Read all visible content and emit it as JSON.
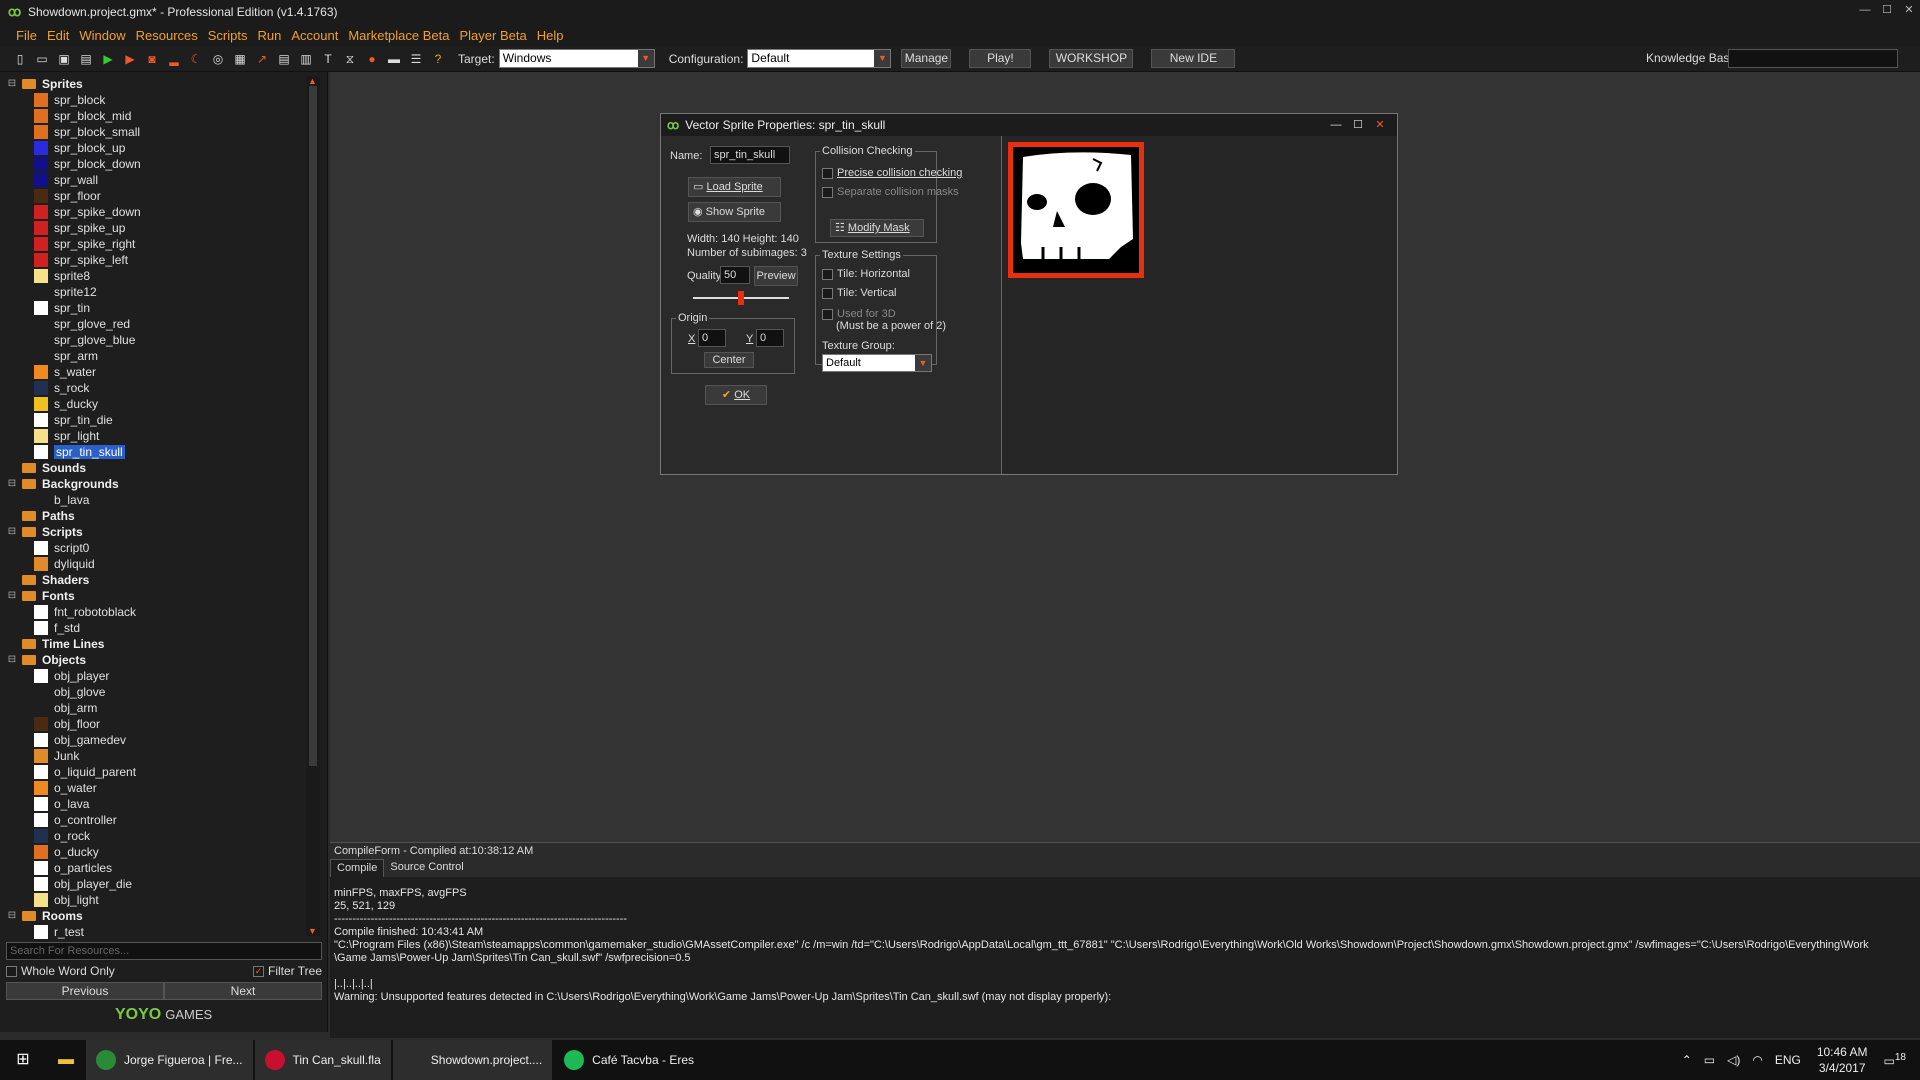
{
  "window": {
    "title": "Showdown.project.gmx* - Professional Edition (v1.4.1763)"
  },
  "menu": [
    "File",
    "Edit",
    "Window",
    "Resources",
    "Scripts",
    "Run",
    "Account",
    "Marketplace Beta",
    "Player Beta",
    "Help"
  ],
  "toolbar": {
    "target_label": "Target:",
    "target_value": "Windows",
    "config_label": "Configuration:",
    "config_value": "Default",
    "manage": "Manage",
    "play": "Play!",
    "workshop": "WORKSHOP",
    "new_ide": "New IDE",
    "kb_label": "Knowledge Base:"
  },
  "tree": [
    {
      "type": "folder",
      "label": "Sprites",
      "expanded": true
    },
    {
      "type": "res",
      "label": "spr_block",
      "color": "#e07020"
    },
    {
      "type": "res",
      "label": "spr_block_mid",
      "color": "#e07020"
    },
    {
      "type": "res",
      "label": "spr_block_small",
      "color": "#e07020"
    },
    {
      "type": "res",
      "label": "spr_block_up",
      "color": "#2a2ae0"
    },
    {
      "type": "res",
      "label": "spr_block_down",
      "color": "#10108a"
    },
    {
      "type": "res",
      "label": "spr_wall",
      "color": "#10108a"
    },
    {
      "type": "res",
      "label": "spr_floor",
      "color": "#4a2a10"
    },
    {
      "type": "res",
      "label": "spr_spike_down",
      "color": "#d02020"
    },
    {
      "type": "res",
      "label": "spr_spike_up",
      "color": "#d02020"
    },
    {
      "type": "res",
      "label": "spr_spike_right",
      "color": "#d02020"
    },
    {
      "type": "res",
      "label": "spr_spike_left",
      "color": "#d02020"
    },
    {
      "type": "res",
      "label": "sprite8",
      "color": "#f6e08a"
    },
    {
      "type": "res",
      "label": "sprite12",
      "color": "#1e1e1e"
    },
    {
      "type": "res",
      "label": "spr_tin",
      "color": "#ffffff"
    },
    {
      "type": "res",
      "label": "spr_glove_red",
      "color": "#1e1e1e"
    },
    {
      "type": "res",
      "label": "spr_glove_blue",
      "color": "#1e1e1e"
    },
    {
      "type": "res",
      "label": "spr_arm",
      "color": "#1e1e1e"
    },
    {
      "type": "res",
      "label": "s_water",
      "color": "#f08a20"
    },
    {
      "type": "res",
      "label": "s_rock",
      "color": "#203050"
    },
    {
      "type": "res",
      "label": "s_ducky",
      "color": "#f0c020"
    },
    {
      "type": "res",
      "label": "spr_tin_die",
      "color": "#ffffff"
    },
    {
      "type": "res",
      "label": "spr_light",
      "color": "#f6e08a"
    },
    {
      "type": "res",
      "label": "spr_tin_skull",
      "color": "#ffffff",
      "selected": true
    },
    {
      "type": "folder",
      "label": "Sounds",
      "expanded": false
    },
    {
      "type": "folder",
      "label": "Backgrounds",
      "expanded": true
    },
    {
      "type": "res",
      "label": "b_lava",
      "color": "#1e1e1e"
    },
    {
      "type": "folder",
      "label": "Paths",
      "expanded": false
    },
    {
      "type": "folder",
      "label": "Scripts",
      "expanded": true
    },
    {
      "type": "res",
      "label": "script0",
      "color": "#ffffff"
    },
    {
      "type": "res",
      "label": "dyliquid",
      "color": "#e08a2a"
    },
    {
      "type": "folder",
      "label": "Shaders",
      "expanded": false
    },
    {
      "type": "folder",
      "label": "Fonts",
      "expanded": true
    },
    {
      "type": "res",
      "label": "fnt_robotoblack",
      "color": "#ffffff"
    },
    {
      "type": "res",
      "label": "f_std",
      "color": "#ffffff"
    },
    {
      "type": "folder",
      "label": "Time Lines",
      "expanded": false
    },
    {
      "type": "folder",
      "label": "Objects",
      "expanded": true
    },
    {
      "type": "res",
      "label": "obj_player",
      "color": "#ffffff"
    },
    {
      "type": "res",
      "label": "obj_glove",
      "color": "#1e1e1e"
    },
    {
      "type": "res",
      "label": "obj_arm",
      "color": "#1e1e1e"
    },
    {
      "type": "res",
      "label": "obj_floor",
      "color": "#4a2a10"
    },
    {
      "type": "res",
      "label": "obj_gamedev",
      "color": "#ffffff"
    },
    {
      "type": "res",
      "label": "Junk",
      "color": "#e08a2a"
    },
    {
      "type": "res",
      "label": "o_liquid_parent",
      "color": "#ffffff"
    },
    {
      "type": "res",
      "label": "o_water",
      "color": "#f08a20"
    },
    {
      "type": "res",
      "label": "o_lava",
      "color": "#ffffff"
    },
    {
      "type": "res",
      "label": "o_controller",
      "color": "#ffffff"
    },
    {
      "type": "res",
      "label": "o_rock",
      "color": "#203050"
    },
    {
      "type": "res",
      "label": "o_ducky",
      "color": "#e07020"
    },
    {
      "type": "res",
      "label": "o_particles",
      "color": "#ffffff"
    },
    {
      "type": "res",
      "label": "obj_player_die",
      "color": "#ffffff"
    },
    {
      "type": "res",
      "label": "obj_light",
      "color": "#f6e08a"
    },
    {
      "type": "folder",
      "label": "Rooms",
      "expanded": true
    },
    {
      "type": "res",
      "label": "r_test",
      "color": "#ffffff"
    }
  ],
  "left_bottom": {
    "search_placeholder": "Search For Resources...",
    "whole_word": "Whole Word Only",
    "filter_tree": "Filter Tree",
    "previous": "Previous",
    "next": "Next",
    "logo_yoyo": "YOYO",
    "logo_games": "GAMES"
  },
  "dialog": {
    "title": "Vector Sprite Properties: spr_tin_skull",
    "name_label": "Name:",
    "name_value": "spr_tin_skull",
    "load_sprite": "Load Sprite",
    "show_sprite": "Show Sprite",
    "width_height": "Width: 140    Height: 140",
    "subimages": "Number of subimages: 3",
    "quality_label": "Quality:",
    "quality_value": "50",
    "preview": "Preview",
    "quality_slider_value": 0.5,
    "origin_title": "Origin",
    "x_label": "X",
    "x_value": "0",
    "y_label": "Y",
    "y_value": "0",
    "center": "Center",
    "ok": "OK",
    "collision_title": "Collision Checking",
    "precise": "Precise collision checking",
    "separate": "Separate collision masks",
    "modify_mask": "Modify Mask",
    "texture_title": "Texture Settings",
    "tile_h": "Tile: Horizontal",
    "tile_v": "Tile: Vertical",
    "used_3d": "Used for 3D",
    "power2": "(Must be a power of 2)",
    "texture_group_label": "Texture Group:",
    "texture_group_value": "Default"
  },
  "compile": {
    "header": "CompileForm - Compiled at:10:38:12 AM",
    "tab_compile": "Compile",
    "tab_source": "Source Control",
    "output": "minFPS, maxFPS, avgFPS\n25, 521, 129\n--------------------------------------------------------------------------------\nCompile finished: 10:43:41 AM\n\"C:\\Program Files (x86)\\Steam\\steamapps\\common\\gamemaker_studio\\GMAssetCompiler.exe\" /c /m=win /td=\"C:\\Users\\Rodrigo\\AppData\\Local\\gm_ttt_67881\" \"C:\\Users\\Rodrigo\\Everything\\Work\\Old Works\\Showdown\\Project\\Showdown.gmx\\Showdown.project.gmx\" /swfimages=\"C:\\Users\\Rodrigo\\Everything\\Work\n\\Game Jams\\Power-Up Jam\\Sprites\\Tin Can_skull.swf\" /swfprecision=0.5\n\n|..|..|..|..|\nWarning: Unsupported features detected in C:\\Users\\Rodrigo\\Everything\\Work\\Game Jams\\Power-Up Jam\\Sprites\\Tin Can_skull.swf (may not display properly):"
  },
  "taskbar": {
    "apps": [
      {
        "label": "Jorge Figueroa | Fre...",
        "icon": "chrome-icon",
        "color": "#2a8a3a"
      },
      {
        "label": "Tin Can_skull.fla",
        "icon": "flash-icon",
        "color": "#c8102e"
      },
      {
        "label": "Showdown.project....",
        "icon": "gamemaker-icon",
        "color": "#2d2d2d"
      },
      {
        "label": "Café Tacvba - Eres",
        "icon": "spotify-icon",
        "color": "#1db954"
      }
    ],
    "lang": "ENG",
    "time": "10:46 AM",
    "date": "3/4/2017",
    "notifications": "18"
  }
}
